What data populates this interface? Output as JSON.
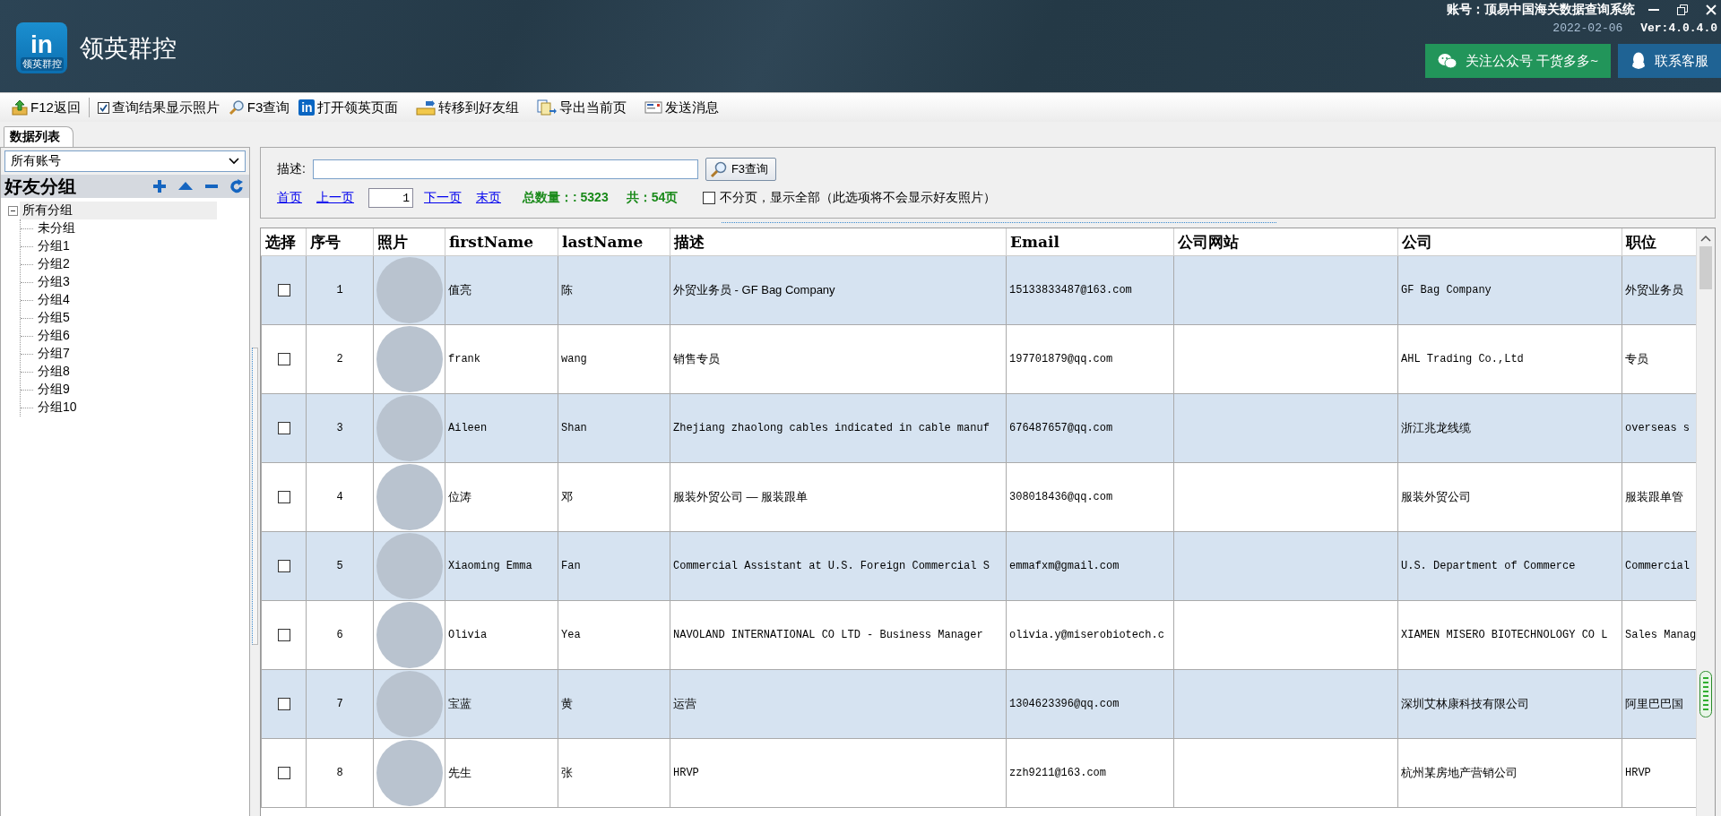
{
  "header": {
    "logo_mark": "in",
    "logo_caption": "领英群控",
    "title": "领英群控",
    "account": "账号：顶易中国海关数据查询系统",
    "date": "2022-02-06",
    "version": "Ver:4.0.4.0",
    "buttons": [
      {
        "label": "关注公众号 干货多多~",
        "kind": "wechat"
      },
      {
        "label": "联系客服",
        "kind": "support"
      }
    ]
  },
  "toolbar": [
    {
      "label": "F12返回",
      "kind": "back"
    },
    {
      "label": "查询结果显示照片",
      "kind": "checkbox",
      "checked": true
    },
    {
      "label": "F3查询",
      "kind": "search"
    },
    {
      "label": "打开领英页面",
      "kind": "linkedin",
      "icon_text": "in"
    },
    {
      "label": "转移到好友组",
      "kind": "transfer"
    },
    {
      "label": "导出当前页",
      "kind": "export"
    },
    {
      "label": "发送消息",
      "kind": "message"
    }
  ],
  "left_panel": {
    "tab": "数据列表",
    "account_select": "所有账号",
    "group_title": "好友分组",
    "tree": [
      {
        "label": "所有分组",
        "expanded": true,
        "selected": true,
        "children": [
          {
            "label": "未分组",
            "selected": false
          },
          {
            "label": "分组1",
            "selected": false
          },
          {
            "label": "分组2",
            "selected": false
          },
          {
            "label": "分组3",
            "selected": false
          },
          {
            "label": "分组4",
            "selected": false
          },
          {
            "label": "分组5",
            "selected": false
          },
          {
            "label": "分组6",
            "selected": false
          },
          {
            "label": "分组7",
            "selected": false
          },
          {
            "label": "分组8",
            "selected": false
          },
          {
            "label": "分组9",
            "selected": false
          },
          {
            "label": "分组10",
            "selected": false
          }
        ]
      }
    ]
  },
  "search": {
    "label": "描述:",
    "button": "F3查询"
  },
  "pager": {
    "first": "首页",
    "prev": "上一页",
    "page": "1",
    "next": "下一页",
    "last": "末页",
    "total": "总数量：: 5323",
    "pages": "共：54页",
    "no_paging": {
      "label": "不分页，显示全部（此选项将不会显示好友照片）",
      "checked": false
    }
  },
  "table": {
    "columns": [
      "选择",
      "序号",
      "照片",
      "firstName",
      "lastName",
      "描述",
      "Email",
      "公司网站",
      "公司",
      "职位"
    ],
    "rows": [
      {
        "checked": false,
        "index": "1",
        "first_name": "值亮",
        "last_name": "陈",
        "description": "外贸业务员 - GF Bag Company",
        "email": "15133833487@163.com",
        "company": "GF Bag Company",
        "position": "外贸业务员"
      },
      {
        "checked": false,
        "index": "2",
        "first_name": "frank",
        "last_name": "wang",
        "description": "销售专员",
        "email": "197701879@qq.com",
        "company": "AHL Trading Co.,Ltd",
        "position": "专员"
      },
      {
        "checked": false,
        "index": "3",
        "first_name": "Aileen",
        "last_name": "Shan",
        "description": "Zhejiang zhaolong cables indicated in cable manuf",
        "email": "676487657@qq.com",
        "company": "浙江兆龙线缆",
        "position": "overseas s"
      },
      {
        "checked": false,
        "index": "4",
        "first_name": "位涛",
        "last_name": "邓",
        "description": "服装外贸公司 — 服装跟单",
        "email": "308018436@qq.com",
        "company": "服装外贸公司",
        "position": "服装跟单管"
      },
      {
        "checked": false,
        "index": "5",
        "first_name": "Xiaoming Emma",
        "last_name": "Fan",
        "description": "Commercial Assistant at U.S. Foreign Commercial S",
        "email": "emmafxm@gmail.com",
        "company": "U.S. Department of Commerce",
        "position": "Commercial"
      },
      {
        "checked": false,
        "index": "6",
        "first_name": "Olivia",
        "last_name": "Yea",
        "description": "NAVOLAND INTERNATIONAL CO LTD - Business Manager",
        "email": "olivia.y@miserobiotech.c",
        "company": "XIAMEN MISERO BIOTECHNOLOGY CO L",
        "position": "Sales Manag"
      },
      {
        "checked": false,
        "index": "7",
        "first_name": "宝蓝",
        "last_name": "黄",
        "description": "运营",
        "email": "1304623396@qq.com",
        "company": "深圳艾林康科技有限公司",
        "position": "阿里巴巴国"
      },
      {
        "checked": false,
        "index": "8",
        "first_name": "先生",
        "last_name": "张",
        "description": "HRVP",
        "email": "zzh9211@163.com",
        "company": "杭州某房地产营销公司",
        "position": "HRVP"
      }
    ]
  }
}
